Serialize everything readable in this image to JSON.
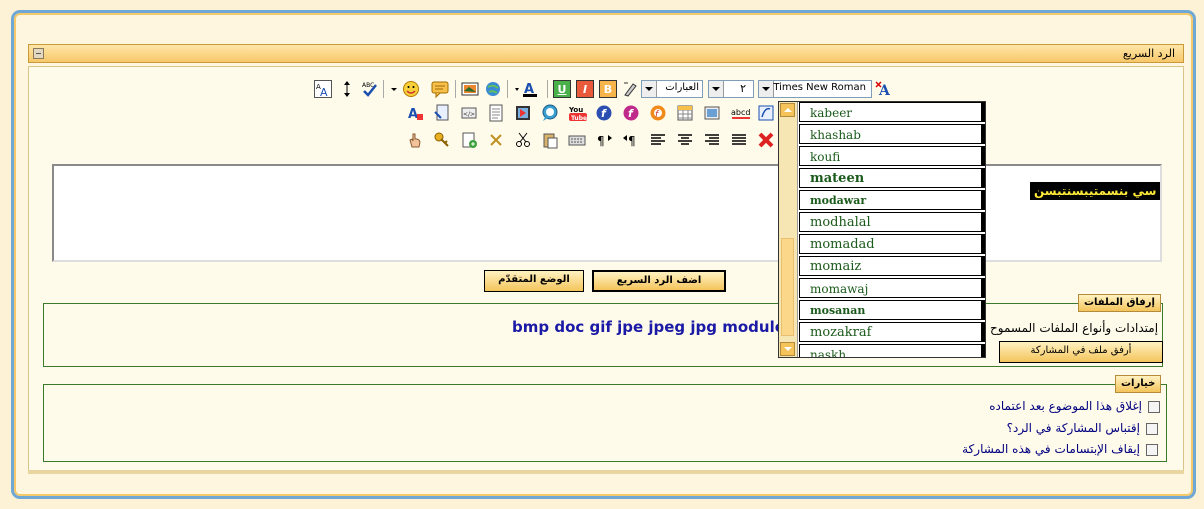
{
  "title": "الرد السريع",
  "toolbar": {
    "font_value": "Times New Roman",
    "size_value": "٢",
    "phrases_value": "العبارات"
  },
  "editor": {
    "content": "سي بنسمتيبسنتبسن"
  },
  "buttons": {
    "quick_reply": "اضف الرد السريع",
    "advanced": "الوضع المتقدّم",
    "attach": "أرفق ملف في المشاركة"
  },
  "attachments": {
    "legend": "إرفاق الملفات",
    "label": "إمتدادات وأنواع الملفات المسموح",
    "extensions": "bmp doc gif jpe jpeg jpg module pd"
  },
  "options": {
    "legend": "خيارات",
    "items": [
      "إغلاق هذا الموضوع بعد اعتماده",
      "إقتباس المشاركة في الرد؟",
      "إيقاف الإبتسامات في هذه المشاركة"
    ]
  },
  "font_dropdown": {
    "items": [
      {
        "name": "kabeer",
        "weight": "normal",
        "size": "12px"
      },
      {
        "name": "khashab",
        "weight": "normal",
        "size": "12px"
      },
      {
        "name": "koufi",
        "weight": "normal",
        "size": "12px"
      },
      {
        "name": "mateen",
        "weight": "bold",
        "size": "13px"
      },
      {
        "name": "modawar",
        "weight": "bold",
        "size": "11px"
      },
      {
        "name": "modhalal",
        "weight": "normal",
        "size": "13px"
      },
      {
        "name": "momadad",
        "weight": "normal",
        "size": "13px"
      },
      {
        "name": "momaiz",
        "weight": "normal",
        "size": "13px"
      },
      {
        "name": "momawaj",
        "weight": "normal",
        "size": "12px"
      },
      {
        "name": "mosanan",
        "weight": "bold",
        "size": "11px"
      },
      {
        "name": "mozakraf",
        "weight": "normal",
        "size": "13px"
      },
      {
        "name": "naskh",
        "weight": "normal",
        "size": "12px"
      }
    ]
  },
  "icons_row1": [
    "font-color-icon",
    "clear-format-icon",
    "bold-icon",
    "italic-icon",
    "underline-icon",
    "text-color-icon",
    "globe-icon",
    "image-icon",
    "comment-icon",
    "smiley-icon",
    "spellcheck-icon",
    "resize-icon",
    "font-size-icon"
  ],
  "colors": {
    "outer_border": "#6fa8d6",
    "title_bar": "#f8c76b",
    "ext_text": "#1a1aa6",
    "editor_text_bg": "#000000",
    "editor_text_fg": "#ffea3a"
  }
}
